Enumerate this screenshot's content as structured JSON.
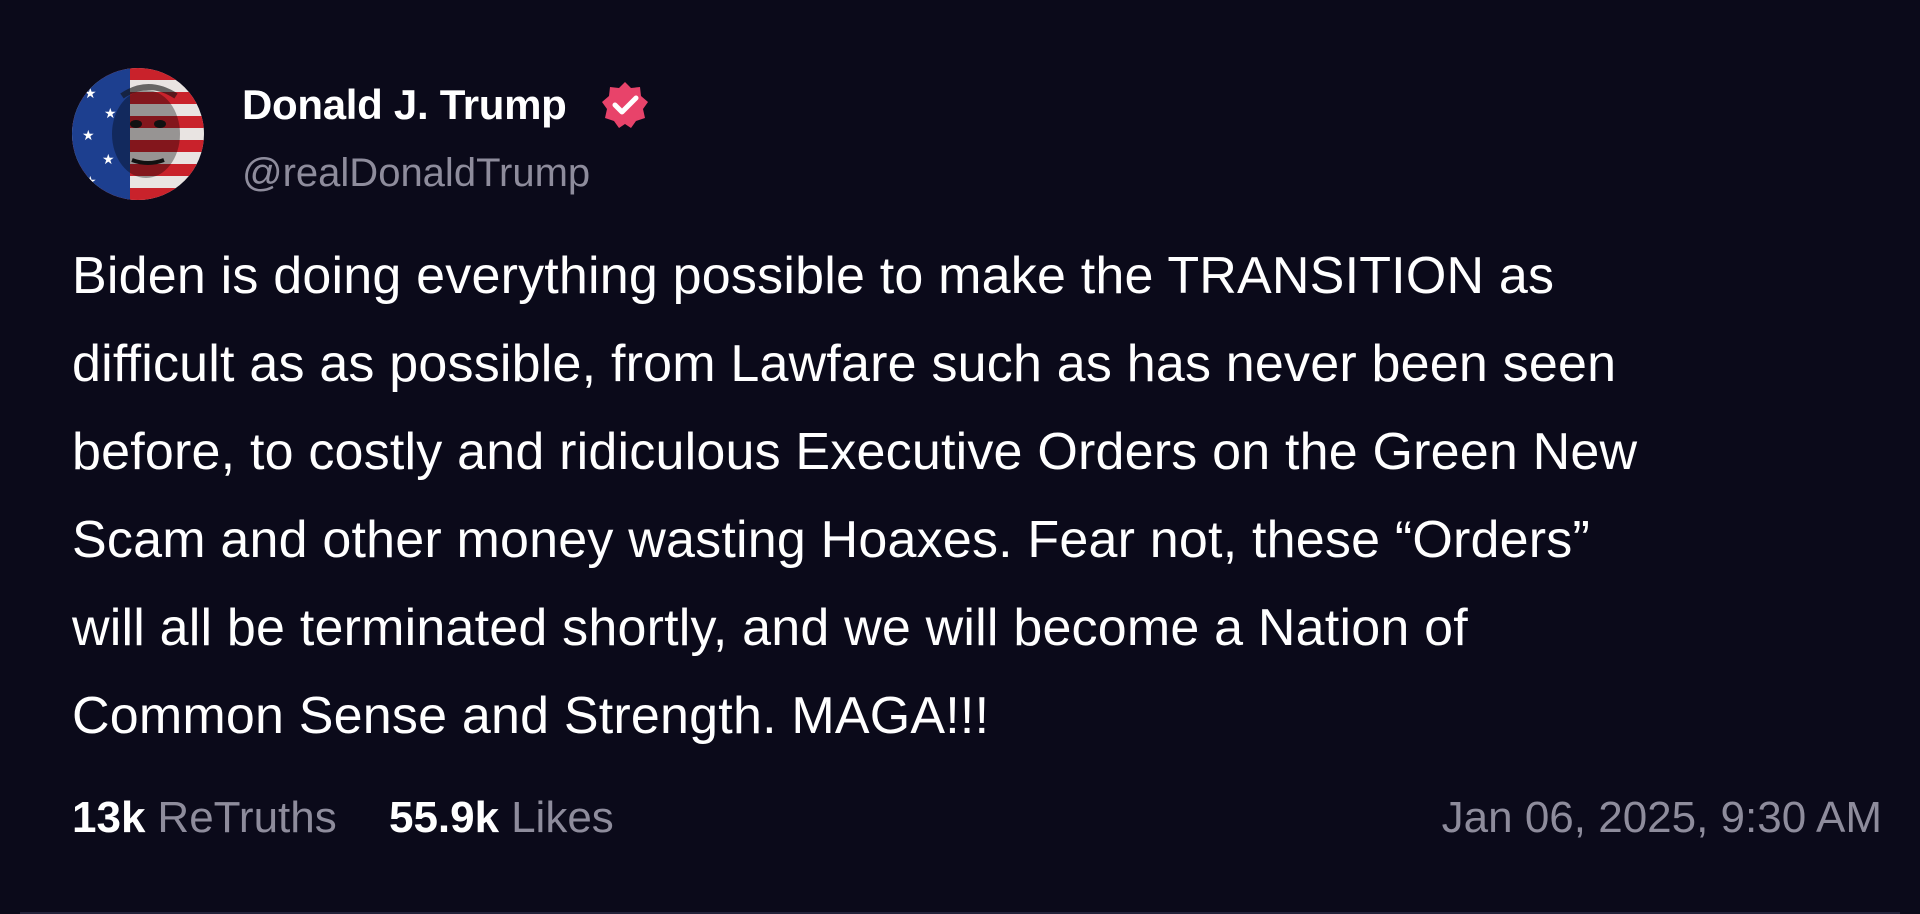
{
  "author": {
    "display_name": "Donald J. Trump",
    "handle": "@realDonaldTrump",
    "verified": true
  },
  "post": {
    "lines": [
      "Biden is doing everything possible to make the TRANSITION as",
      "difficult as as possible, from Lawfare such as has never been seen",
      "before, to costly and ridiculous Executive Orders on the Green New",
      "Scam and other money wasting Hoaxes. Fear not, these “Orders”",
      "will all be terminated shortly, and we will become a Nation of",
      "Common Sense and Strength. MAGA!!!"
    ]
  },
  "stats": {
    "retruths_count": "13k",
    "retruths_label": "ReTruths",
    "likes_count": "55.9k",
    "likes_label": "Likes"
  },
  "timestamp": "Jan 06, 2025, 9:30 AM",
  "colors": {
    "background": "#0b0a1a",
    "text_primary": "#ffffff",
    "text_secondary": "#8e8c9c",
    "verified_badge": "#e8436a"
  },
  "icons": {
    "verified": "verified-badge-icon",
    "avatar": "user-avatar"
  }
}
